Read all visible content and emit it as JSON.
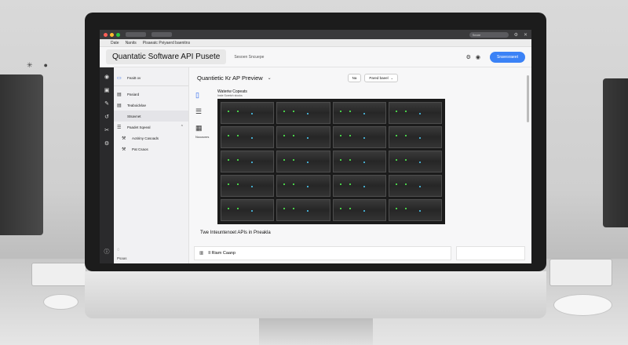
{
  "header": {
    "title": "Quantatic Software API Pusete",
    "subtitle": "Sesoen Sncuepe",
    "primary_button": "Sravesraeet"
  },
  "menubar": [
    "Date",
    "Nanits",
    "Pisaeatc Pviyaerd baenitns"
  ],
  "browser": {
    "search": "Seare"
  },
  "sidebar": {
    "items": [
      {
        "label": "Feaitt ov",
        "icon": "folder-icon"
      },
      {
        "label": "Pasiard",
        "icon": "doc-icon"
      },
      {
        "label": "Teaboidvlae",
        "icon": "doc-icon"
      },
      {
        "label": "Stsavnet",
        "icon": "doc-icon"
      },
      {
        "label": "Paadet Sqeeal",
        "icon": "list-icon"
      },
      {
        "label": "Aotiriny Casoads",
        "icon": "tool-icon"
      },
      {
        "label": "Pat Csaos",
        "icon": "tool-icon"
      }
    ],
    "bottom_label": "Psaas"
  },
  "main": {
    "title": "Quantietic Kr AP Preview",
    "controls": [
      "Na",
      "Pared baeel"
    ],
    "preview_caption": "Wateriw Copeats",
    "preview_subcaption": "Inste Soretch stooks",
    "side_label": "Nooaonrs",
    "section_label": "Twe Inteuntenoet APIs in Pneakla",
    "list_row": "Il Riam Caanp"
  },
  "icons": {
    "rail": [
      "record-icon",
      "box-icon",
      "pen-icon",
      "history-icon",
      "scissors-icon",
      "gear-icon"
    ],
    "rail_bottom": "info-icon"
  },
  "colors": {
    "accent": "#3b82f6",
    "rail": "#2a2a2c"
  }
}
